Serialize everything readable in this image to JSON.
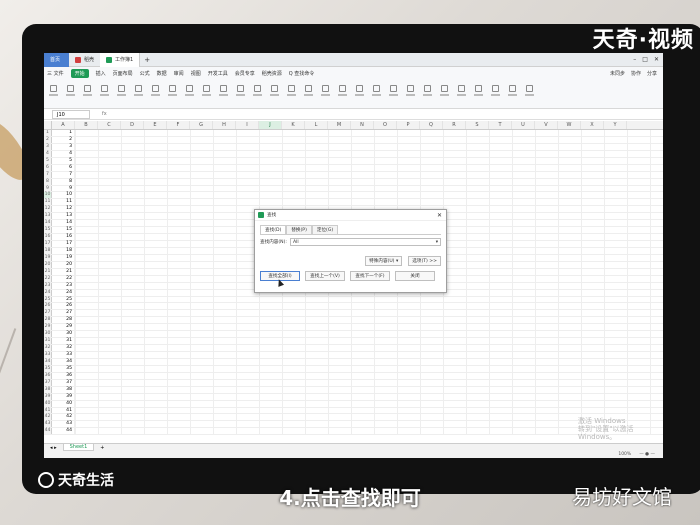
{
  "watermarks": {
    "top_right": "天奇·视频",
    "bottom_left": "天奇生活",
    "caption": "4.点击查找即可",
    "bottom_right": "易坊好文馆"
  },
  "tabs": [
    {
      "label": "首页"
    },
    {
      "label": "稻壳"
    },
    {
      "label": "工作簿1"
    }
  ],
  "menu": {
    "file": "三 文件",
    "start": "开始",
    "items": [
      "插入",
      "页面布局",
      "公式",
      "数据",
      "审阅",
      "视图",
      "开发工具",
      "会员专享",
      "稻壳资源"
    ],
    "search": "Q 查找命令",
    "right": [
      "未同步",
      "协作",
      "分享"
    ]
  },
  "formula_bar": {
    "cell_ref": "J10",
    "fx": "fx"
  },
  "columns": [
    "A",
    "B",
    "C",
    "D",
    "E",
    "F",
    "G",
    "H",
    "I",
    "J",
    "K",
    "L",
    "M",
    "N",
    "O",
    "P",
    "Q",
    "R",
    "S",
    "T",
    "U",
    "V",
    "W",
    "X",
    "Y"
  ],
  "rows": [
    "1",
    "2",
    "3",
    "4",
    "5",
    "6",
    "7",
    "8",
    "9",
    "10",
    "11",
    "12",
    "13",
    "14",
    "15",
    "16",
    "17",
    "18",
    "19",
    "20",
    "21",
    "22",
    "23",
    "24",
    "25",
    "26",
    "27",
    "28",
    "29",
    "30",
    "31",
    "32",
    "33",
    "34",
    "35",
    "36",
    "37",
    "38",
    "39",
    "40",
    "41",
    "42",
    "43",
    "44"
  ],
  "sheet": {
    "tab": "Sheet1"
  },
  "activation": {
    "line1": "激活 Windows",
    "line2": "转到\"设置\"以激活 Windows。"
  },
  "status": {
    "zoom": "100%"
  },
  "dialog": {
    "title": "查找",
    "tabs": [
      "查找(D)",
      "替换(P)",
      "定位(G)"
    ],
    "find_label": "查找内容(N):",
    "find_value": "All",
    "special_button": "特殊内容(U) ▾",
    "options_button": "选项(T) >>",
    "buttons": [
      "查找全部(I)",
      "查找上一个(V)",
      "查找下一个(F)",
      "关闭"
    ]
  }
}
